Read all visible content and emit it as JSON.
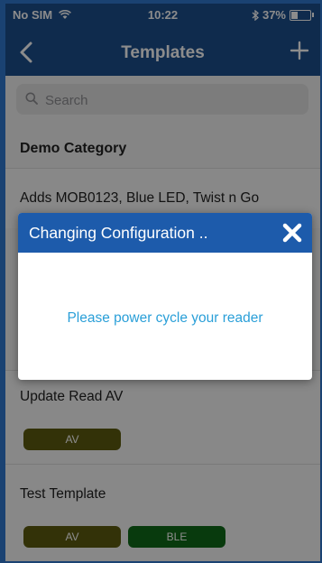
{
  "status_bar": {
    "carrier": "No SIM",
    "time": "10:22",
    "battery": "37%",
    "battery_level": 0.37
  },
  "nav": {
    "title": "Templates"
  },
  "search": {
    "placeholder": "Search"
  },
  "category": "Demo Category",
  "templates": [
    {
      "title": "Adds MOB0123, Blue LED, Twist n Go",
      "tags": []
    },
    {
      "title": "Update Read AV",
      "tags": [
        {
          "label": "AV",
          "color": "#5d5c10"
        }
      ]
    },
    {
      "title": "Test Template",
      "tags": [
        {
          "label": "AV",
          "color": "#5d5c10"
        },
        {
          "label": "BLE",
          "color": "#0f6b19"
        }
      ]
    }
  ],
  "dialog": {
    "title": "Changing Configuration ..",
    "message": "Please power cycle your reader"
  },
  "colors": {
    "nav": "#1d4f8d",
    "dialog_header": "#1d5bab",
    "message": "#2a9fd8",
    "av": "#5d5c10",
    "ble": "#0f6b19"
  },
  "icons": {
    "back": "chevron-left-icon",
    "add": "plus-icon",
    "search": "magnifier-icon",
    "close": "close-icon",
    "bluetooth": "bluetooth-icon",
    "wifi": "wifi-icon"
  }
}
